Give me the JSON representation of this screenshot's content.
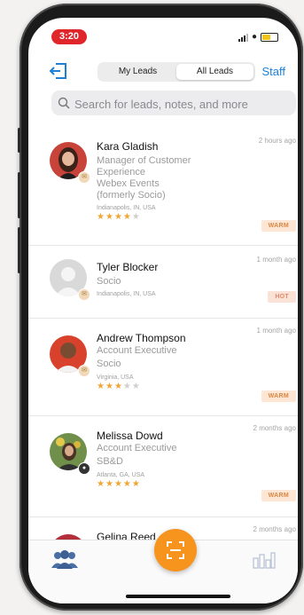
{
  "status_bar": {
    "time": "3:20"
  },
  "header": {
    "tabs": [
      {
        "label": "My Leads",
        "active": false
      },
      {
        "label": "All Leads",
        "active": true
      }
    ],
    "staff_label": "Staff"
  },
  "search": {
    "placeholder": "Search for leads, notes, and more",
    "value": ""
  },
  "leads": [
    {
      "name": "Kara Gladish",
      "title_lines": [
        "Manager of Customer",
        "Experience",
        "Webex Events",
        "(formerly Socio)"
      ],
      "location": "Indianapolis, IN, USA",
      "rating": 4,
      "max_rating": 5,
      "time_ago": "2 hours ago",
      "tag": "WARM"
    },
    {
      "name": "Tyler Blocker",
      "title_lines": [
        "Socio"
      ],
      "location": "Indianapolis, IN, USA",
      "rating": 0,
      "max_rating": 5,
      "time_ago": "1 month ago",
      "tag": "HOT"
    },
    {
      "name": "Andrew Thompson",
      "title_lines": [
        "Account Executive",
        "Socio"
      ],
      "location": "Virginia, USA",
      "rating": 3,
      "max_rating": 5,
      "time_ago": "1 month ago",
      "tag": "WARM"
    },
    {
      "name": "Melissa Dowd",
      "title_lines": [
        "Account Executive",
        "SB&D"
      ],
      "location": "Atlanta, GA, USA",
      "rating": 5,
      "max_rating": 5,
      "time_ago": "2 months ago",
      "tag": "WARM"
    },
    {
      "name": "Gelina Reed",
      "title_lines": [],
      "location": "",
      "time_ago": "2 months ago",
      "tag": ""
    }
  ],
  "tabbar": {
    "left_icon": "people-icon",
    "center_icon": "scan-icon",
    "right_icon": "bar-chart-icon"
  },
  "colors": {
    "accent_blue": "#1f7fd8",
    "scan_orange": "#f7941d",
    "status_red": "#e0262b",
    "star": "#efa634",
    "warm_tag_bg": "#fde7d4",
    "warm_tag_text": "#d98640"
  }
}
